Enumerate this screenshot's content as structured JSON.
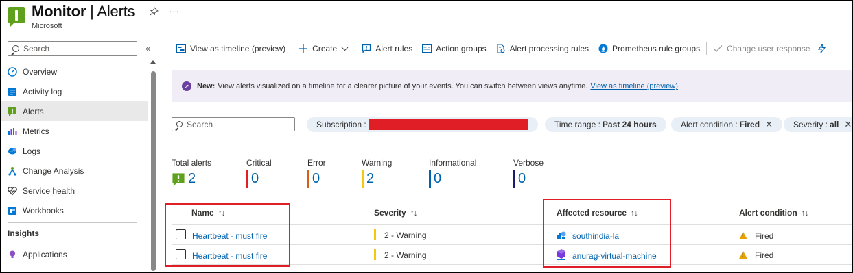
{
  "header": {
    "title_main": "Monitor",
    "title_sep": " | ",
    "title_page": "Alerts",
    "subtitle": "Microsoft",
    "more_label": "···"
  },
  "sidebar": {
    "search_placeholder": "Search",
    "collapse_label": "«",
    "items": [
      {
        "label": "Overview",
        "icon": "overview-icon"
      },
      {
        "label": "Activity log",
        "icon": "activity-log-icon"
      },
      {
        "label": "Alerts",
        "icon": "alerts-icon",
        "active": true
      },
      {
        "label": "Metrics",
        "icon": "metrics-icon"
      },
      {
        "label": "Logs",
        "icon": "logs-icon"
      },
      {
        "label": "Change Analysis",
        "icon": "change-analysis-icon"
      },
      {
        "label": "Service health",
        "icon": "heart-icon"
      },
      {
        "label": "Workbooks",
        "icon": "workbooks-icon"
      }
    ],
    "section_insights": "Insights",
    "insights_items": [
      {
        "label": "Applications",
        "icon": "lightbulb-icon"
      }
    ]
  },
  "toolbar": {
    "view_timeline": "View as timeline (preview)",
    "create": "Create",
    "alert_rules": "Alert rules",
    "action_groups": "Action groups",
    "alert_processing_rules": "Alert processing rules",
    "prometheus_rule_groups": "Prometheus rule groups",
    "change_user_response": "Change user response"
  },
  "banner": {
    "bold": "New:",
    "text": "View alerts visualized on a timeline for a clearer picture of your events. You can switch between views anytime.",
    "link": "View as timeline (preview)"
  },
  "filters": {
    "search_placeholder": "Search",
    "subscription_label": "Subscription :",
    "time_range_label": "Time range :",
    "time_range_value": "Past 24 hours",
    "alert_condition_label": "Alert condition :",
    "alert_condition_value": "Fired",
    "severity_label": "Severity :",
    "severity_value": "all"
  },
  "summary": {
    "total_label": "Total alerts",
    "total": "2",
    "critical_label": "Critical",
    "critical": "0",
    "error_label": "Error",
    "error": "0",
    "warning_label": "Warning",
    "warning": "2",
    "informational_label": "Informational",
    "informational": "0",
    "verbose_label": "Verbose",
    "verbose": "0",
    "colors": {
      "critical": "#e01e26",
      "error": "#da5f14",
      "warning": "#f2c811",
      "informational": "#0062ad",
      "verbose": "#1a1b6e"
    }
  },
  "table": {
    "columns": {
      "name": "Name",
      "severity": "Severity",
      "affected_resource": "Affected resource",
      "alert_condition": "Alert condition"
    },
    "sort_glyph": "↑↓",
    "rows": [
      {
        "name": "Heartbeat - must fire",
        "severity": "2 - Warning",
        "resource": "southindia-la",
        "resource_icon": "log-analytics-icon",
        "condition": "Fired"
      },
      {
        "name": "Heartbeat - must fire",
        "severity": "2 - Warning",
        "resource": "anurag-virtual-machine",
        "resource_icon": "virtual-machine-icon",
        "condition": "Fired"
      }
    ]
  },
  "colors": {
    "accent": "#0062ad",
    "alerts_green": "#5fa11c",
    "highlight_red": "#e01e26",
    "banner_bg": "#f1edf6"
  }
}
